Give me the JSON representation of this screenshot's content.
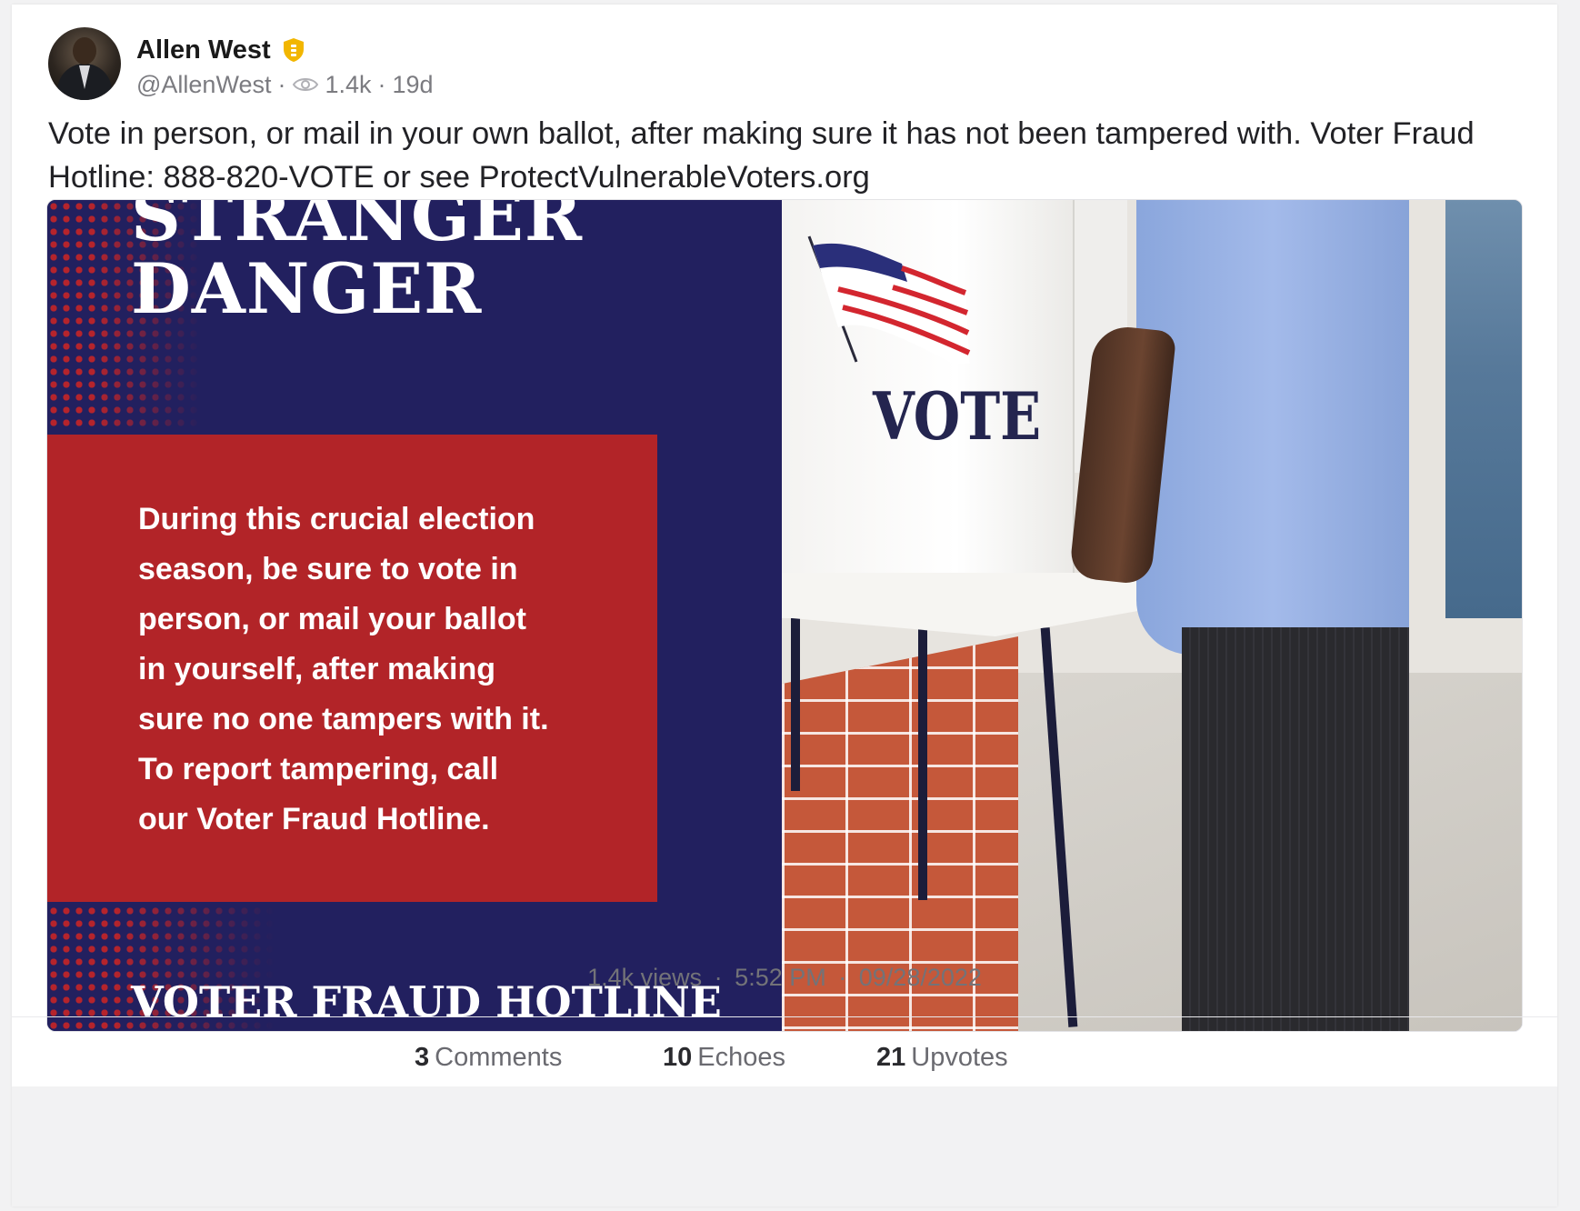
{
  "author": {
    "name": "Allen West",
    "handle": "@AllenWest",
    "views_short": "1.4k",
    "age": "19d",
    "badge_icon": "verified-shield-icon",
    "badge_color": "#f2b600"
  },
  "post": {
    "text": "Vote in person, or mail in your own ballot, after making sure it has not been tampered with. Voter Fraud Hotline: 888-820-VOTE or see ProtectVulnerableVoters.org"
  },
  "media": {
    "headline_line1": "STRANGER",
    "headline_line2": "DANGER",
    "body": [
      "During this crucial election",
      "season, be sure to vote in",
      "person, or mail your ballot",
      "in yourself, after making",
      "sure no one tampers with it.",
      "To report tampering, call",
      "our Voter Fraud Hotline."
    ],
    "footer": "VOTER FRAUD HOTLINE",
    "booth_sign": "VOTE",
    "colors": {
      "navy": "#22205f",
      "red": "#b22428"
    }
  },
  "footer": {
    "views": "1.4k views",
    "time": "5:52 PM",
    "date": "09/28/2022",
    "separator": "·"
  },
  "stats": {
    "comments_count": "3",
    "comments_label": "Comments",
    "echoes_count": "10",
    "echoes_label": "Echoes",
    "upvotes_count": "21",
    "upvotes_label": "Upvotes"
  }
}
